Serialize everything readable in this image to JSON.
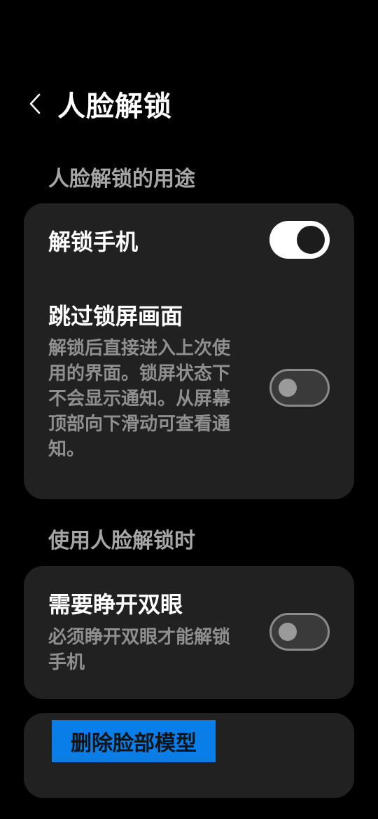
{
  "header": {
    "title": "人脸解锁"
  },
  "sections": {
    "usage_label": "人脸解锁的用途",
    "when_using_label": "使用人脸解锁时"
  },
  "usage_card": {
    "unlock_phone": {
      "title": "解锁手机",
      "enabled": true
    },
    "skip_lock_screen": {
      "title": "跳过锁屏画面",
      "desc_lines": [
        "解锁后直接进入上次使",
        "用的界面。锁屏状态下",
        "不会显示通知。从屏幕",
        "顶部向下滑动可查看通",
        "知。"
      ],
      "enabled": false
    }
  },
  "when_card": {
    "require_eyes_open": {
      "title": "需要睁开双眼",
      "desc_lines": [
        "必须睁开双眼才能解锁",
        "手机"
      ],
      "enabled": false
    }
  },
  "delete_card": {
    "delete_label": "删除脸部模型",
    "color": "#0a7ee8"
  },
  "icons": {
    "back": "chevron-left-icon"
  }
}
